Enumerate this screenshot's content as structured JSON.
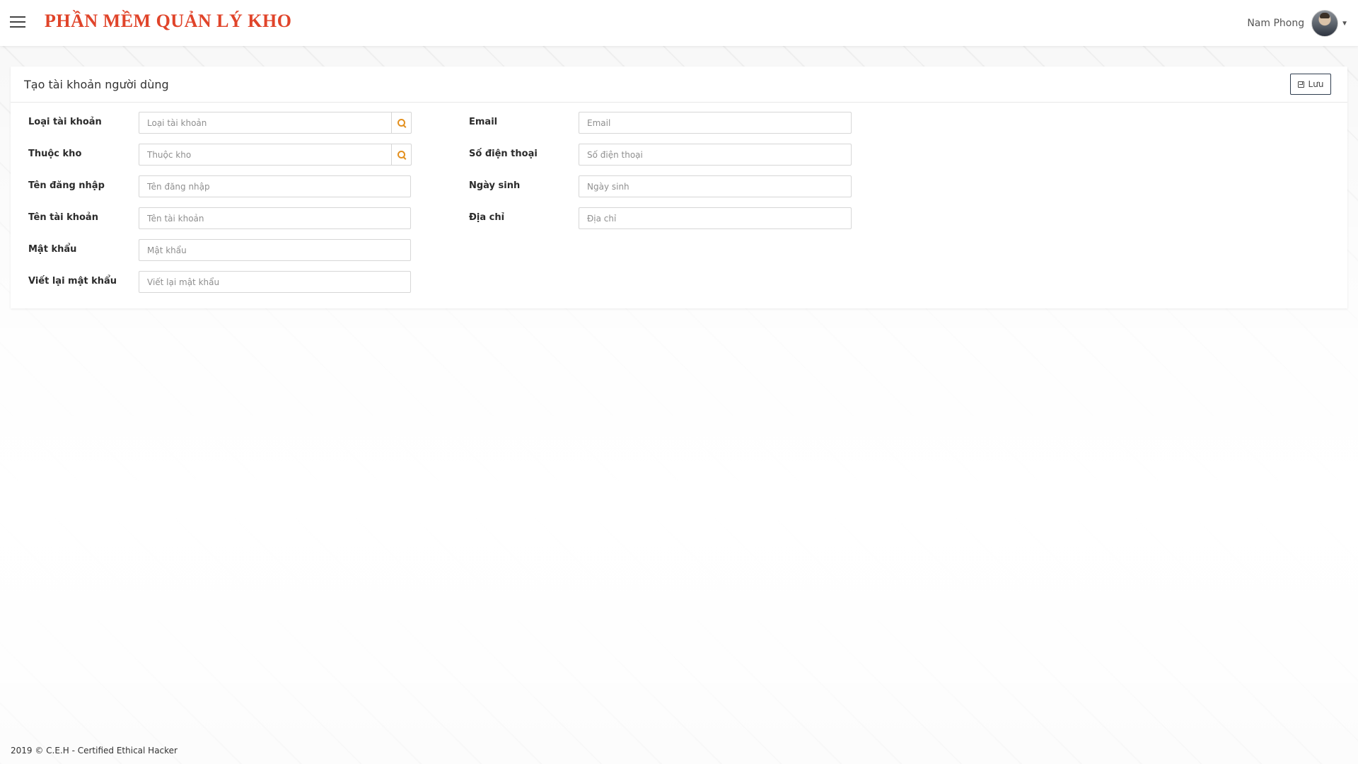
{
  "app": {
    "brand": "PHẦN MỀM QUẢN LÝ KHO",
    "user_name": "Nam Phong"
  },
  "card": {
    "title": "Tạo tài khoản người dùng",
    "save_label": "Lưu"
  },
  "form": {
    "left": [
      {
        "label": "Loại tài khoản",
        "placeholder": "Loại tài khoản",
        "value": "",
        "has_search": true
      },
      {
        "label": "Thuộc kho",
        "placeholder": "Thuộc kho",
        "value": "",
        "has_search": true
      },
      {
        "label": "Tên đăng nhập",
        "placeholder": "Tên đăng nhập",
        "value": "",
        "has_search": false
      },
      {
        "label": "Tên tài khoản",
        "placeholder": "Tên tài khoản",
        "value": "",
        "has_search": false
      },
      {
        "label": "Mật khẩu",
        "placeholder": "Mật khẩu",
        "value": "",
        "has_search": false
      },
      {
        "label": "Viết lại mật khẩu",
        "placeholder": "Viết lại mật khẩu",
        "value": "",
        "has_search": false
      }
    ],
    "right": [
      {
        "label": "Email",
        "placeholder": "Email",
        "value": ""
      },
      {
        "label": "Số điện thoại",
        "placeholder": "Số điện thoại",
        "value": ""
      },
      {
        "label": "Ngày sinh",
        "placeholder": "Ngày sinh",
        "value": ""
      },
      {
        "label": "Địa chỉ",
        "placeholder": "Địa chỉ",
        "value": ""
      }
    ]
  },
  "footer": {
    "text": "2019 © C.E.H - Certified Ethical Hacker"
  },
  "colors": {
    "brand": "#e0442a",
    "search_icon": "#e3901f",
    "save_border": "#2f3d4f"
  }
}
